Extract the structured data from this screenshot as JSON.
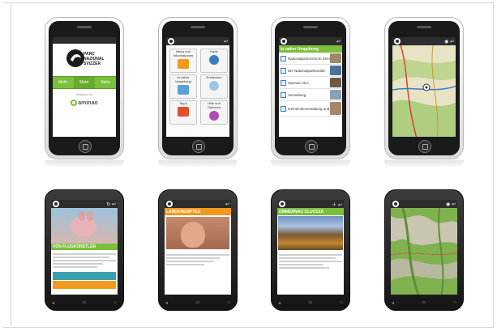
{
  "screens": {
    "s1": {
      "brand_lines": [
        "PARC",
        "NAZIUNAL",
        "SVIZZER"
      ],
      "sponsor_caption": "Ergänzung",
      "sponsor_name": "aminao",
      "tab_labels": [
        "Mehr",
        "Mehr",
        "Mehr"
      ]
    },
    "s2": {
      "tiles": [
        {
          "label": "News und Informationen",
          "icon": "news-icon"
        },
        {
          "label": "Karte",
          "icon": "globe-icon"
        },
        {
          "label": "In naher Umgebung",
          "icon": "compass-icon"
        },
        {
          "label": "Entdecken",
          "icon": "search-icon"
        },
        {
          "label": "Tag 6",
          "icon": "calendar-icon"
        },
        {
          "label": "Hilfe und Optionen",
          "icon": "help-icon"
        }
      ]
    },
    "s3": {
      "header": "In naher Umgebung",
      "rows": [
        "Nationalparkzentrum Zernez",
        "Die Nationalparkstraße",
        "Openair Alvo",
        "Verwaltung",
        "Gemeindeverwaltung und Spiel"
      ]
    },
    "s5": {
      "banner": "VON FLUGKÜNSTLER"
    },
    "s6": {
      "header": "LANDKREISPTES"
    },
    "s7": {
      "header": "OMMERNAU CLUOZZA"
    }
  },
  "colors": {
    "accent_green": "#7bbf3a",
    "map_green": "#7fb24f",
    "accent_orange": "#f29a1d",
    "accent_blue": "#3a7cc2",
    "phone_black": "#151515"
  }
}
